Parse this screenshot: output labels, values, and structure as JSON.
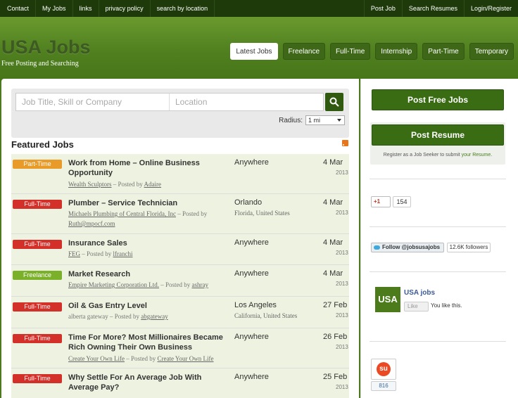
{
  "topnav": {
    "left": [
      "Contact",
      "My Jobs",
      "links",
      "privacy policy",
      "search by location"
    ],
    "right": [
      "Post Job",
      "Search Resumes",
      "Login/Register"
    ]
  },
  "header": {
    "logo": "USA Jobs",
    "tagline": "Free Posting and Searching",
    "tabs": [
      {
        "label": "Latest Jobs",
        "active": true
      },
      {
        "label": "Freelance",
        "active": false
      },
      {
        "label": "Full-Time",
        "active": false
      },
      {
        "label": "Internship",
        "active": false
      },
      {
        "label": "Part-Time",
        "active": false
      },
      {
        "label": "Temporary",
        "active": false
      }
    ]
  },
  "search": {
    "keyword_placeholder": "Job Title, Skill or Company",
    "location_placeholder": "Location",
    "radius_label": "Radius:",
    "radius_value": "1 mi"
  },
  "featured": {
    "title": "Featured Jobs",
    "jobs": [
      {
        "type": "Part-Time",
        "title": "Work from Home – Online Business Opportunity",
        "company": "Wealth Sculptors",
        "posted_by": "Adaire",
        "location": "Anywhere",
        "location_detail": "",
        "date": "4 Mar",
        "year": "2013"
      },
      {
        "type": "Full-Time",
        "title": "Plumber – Service Technician",
        "company": "Michaels Plumbing of Central Florida, Inc",
        "posted_by": "Ruth@mpocf.com",
        "location": "Orlando",
        "location_detail": "Florida, United States",
        "date": "4 Mar",
        "year": "2013"
      },
      {
        "type": "Full-Time",
        "title": "Insurance Sales",
        "company": "FEG",
        "posted_by": "lfranchi",
        "location": "Anywhere",
        "location_detail": "",
        "date": "4 Mar",
        "year": "2013"
      },
      {
        "type": "Freelance",
        "title": "Market Research",
        "company": "Empire Marketing Corporation Ltd.",
        "posted_by": "ashray",
        "location": "Anywhere",
        "location_detail": "",
        "date": "4 Mar",
        "year": "2013"
      },
      {
        "type": "Full-Time",
        "title": "Oil & Gas Entry Level",
        "company": "alberta gateway",
        "posted_by": "abgateway",
        "location": "Los Angeles",
        "location_detail": "California, United States",
        "date": "27 Feb",
        "year": "2013"
      },
      {
        "type": "Full-Time",
        "title": "Time For More? Most Millionaires Became Rich Owning Their Own Business",
        "company": "Create Your Own Life",
        "posted_by": "Create Your Own Life",
        "location": "Anywhere",
        "location_detail": "",
        "date": "26 Feb",
        "year": "2013"
      },
      {
        "type": "Full-Time",
        "title": "Why Settle For An Average Job With Average Pay?",
        "company": "",
        "posted_by": "",
        "location": "Anywhere",
        "location_detail": "",
        "date": "25 Feb",
        "year": "2013"
      }
    ],
    "posted_by_text": "– Posted by"
  },
  "sidebar": {
    "post_jobs": "Post Free Jobs",
    "post_resume": "Post Resume",
    "resume_note": "Register as a Job Seeker to submit ",
    "resume_link": "your Resume",
    "resume_end": ".",
    "gplus_label": "+1",
    "gplus_count": "154",
    "twitter_label": "Follow @jobsusajobs",
    "twitter_count": "12.6K followers",
    "fb_logo": "USA J",
    "fb_name": "USA jobs",
    "fb_like": "Like",
    "fb_text": "You like this.",
    "su_count": "816"
  },
  "colors": {
    "full_time": "#d3302a",
    "part_time": "#e99b2a",
    "freelance": "#7bb02b",
    "accent": "#3a6c14"
  }
}
